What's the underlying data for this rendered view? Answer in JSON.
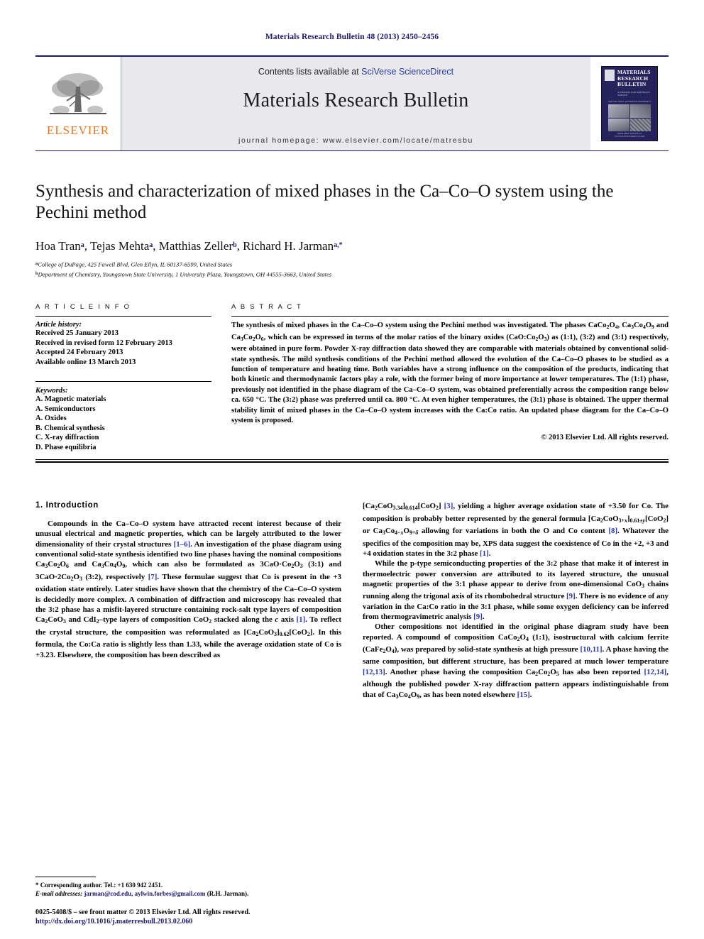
{
  "running_head": "Materials Research Bulletin 48 (2013) 2450–2456",
  "masthead": {
    "contents_prefix": "Contents lists available at ",
    "contents_link": "SciVerse ScienceDirect",
    "journal_title": "Materials Research Bulletin",
    "homepage": "journal homepage: www.elsevier.com/locate/matresbu",
    "publisher_wordmark": "ELSEVIER",
    "publisher_color": "#E87722",
    "cover": {
      "title_line1": "MATERIALS",
      "title_line2": "RESEARCH",
      "title_line3": "BULLETIN",
      "subtitle": "A JOURNAL FOR MATERIALS SCIENCE",
      "caption": "SPECIAL ISSUE: ADVANCED MATERIALS",
      "footer": "AVAILABLE ONLINE AT WWW.SCIENCEDIRECT.COM",
      "background_color": "#26235c"
    }
  },
  "article": {
    "title": "Synthesis and characterization of mixed phases in the Ca–Co–O system using the Pechini method",
    "authors": [
      {
        "name": "Hoa Tran",
        "marks": "a"
      },
      {
        "name": "Tejas Mehta",
        "marks": "a"
      },
      {
        "name": "Matthias Zeller",
        "marks": "b"
      },
      {
        "name": "Richard H. Jarman",
        "marks": "a,*"
      }
    ],
    "affiliations": [
      {
        "mark": "a",
        "text": "College of DuPage, 425 Fawell Blvd, Glen Ellyn, IL 60137-6599, United States"
      },
      {
        "mark": "b",
        "text": "Department of Chemistry, Youngstown State University, 1 University Plaza, Youngstown, OH 44555-3663, United States"
      }
    ]
  },
  "info": {
    "heading": "A R T I C L E   I N F O",
    "history_title": "Article history:",
    "history": [
      "Received 25 January 2013",
      "Received in revised form 12 February 2013",
      "Accepted 24 February 2013",
      "Available online 13 March 2013"
    ],
    "keywords_title": "Keywords:",
    "keywords": [
      "A. Magnetic materials",
      "A. Semiconductors",
      "A. Oxides",
      "B. Chemical synthesis",
      "C. X-ray diffraction",
      "D. Phase equilibria"
    ]
  },
  "abstract": {
    "heading": "A B S T R A C T",
    "copyright": "© 2013 Elsevier Ltd. All rights reserved."
  },
  "sections": {
    "intro_heading": "1.  Introduction"
  },
  "footnote": {
    "corresponding": "* Corresponding author. Tel.: +1 630 942 2451.",
    "email_label": "E-mail addresses:",
    "emails": "jarman@cod.edu, aylwin.forbes@gmail.com",
    "email_owner": "(R.H. Jarman)."
  },
  "footer": {
    "issn_line": "0025-5408/$ – see front matter © 2013 Elsevier Ltd. All rights reserved.",
    "doi": "http://dx.doi.org/10.1016/j.materresbull.2013.02.060",
    "link_color": "#1a1a6e"
  }
}
